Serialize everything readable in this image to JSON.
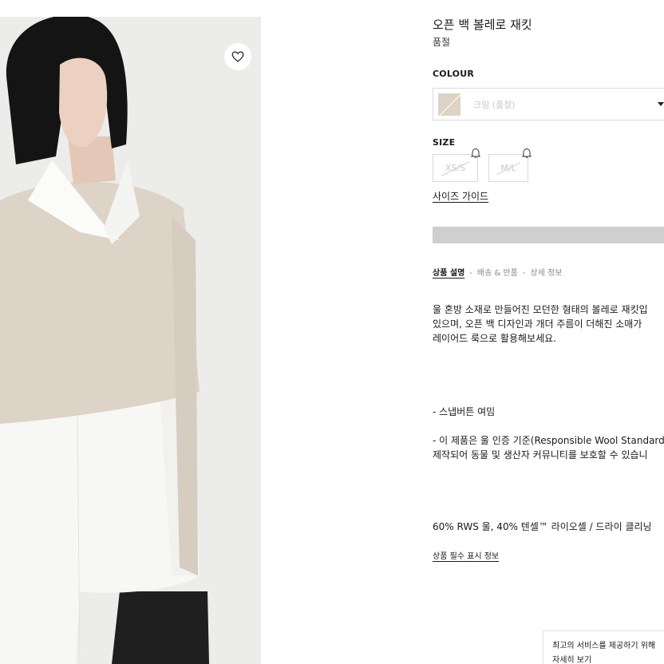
{
  "product": {
    "title": "오픈 백 볼레로 재킷",
    "stock_status": "품절"
  },
  "colour": {
    "label": "COLOUR",
    "selected": "크림 (품절)",
    "swatch_color": "#ddd3c6"
  },
  "size": {
    "label": "SIZE",
    "options": [
      "XS/S",
      "M/L"
    ],
    "guide_link": "사이즈 가이드"
  },
  "tabs": {
    "description": "상품 설명",
    "shipping": "배송 & 반품",
    "details": "상세 정보",
    "separator": "-"
  },
  "description": {
    "lines": [
      "울 혼방 소재로 만들어진 모던한 형태의 볼레로 재킷입",
      "있으며, 오픈 백 디자인과 개더 주름이 더해진 소매가",
      "레이어드 룩으로 활용해보세요."
    ],
    "bullet_1": "- 스냅버튼 여밈",
    "bullet_2_lines": [
      "- 이 제품은 울 인증 기준(Responsible Wool Standard",
      "제작되어 동물 및 생산자 커뮤니티를 보호할 수 있습니"
    ],
    "composition": "60% RWS 울, 40% 텐셀™ 라이오셀 / 드라이 클리닝",
    "required_info_link": "상품 필수 표시 정보"
  },
  "cookie_banner": {
    "line_1": "최고의 서비스를 제공하기 위해",
    "line_2": "자세히 보기"
  },
  "icons": {
    "wishlist": "heart-icon",
    "notify": "bell-icon",
    "dropdown": "chevron-down-icon"
  }
}
